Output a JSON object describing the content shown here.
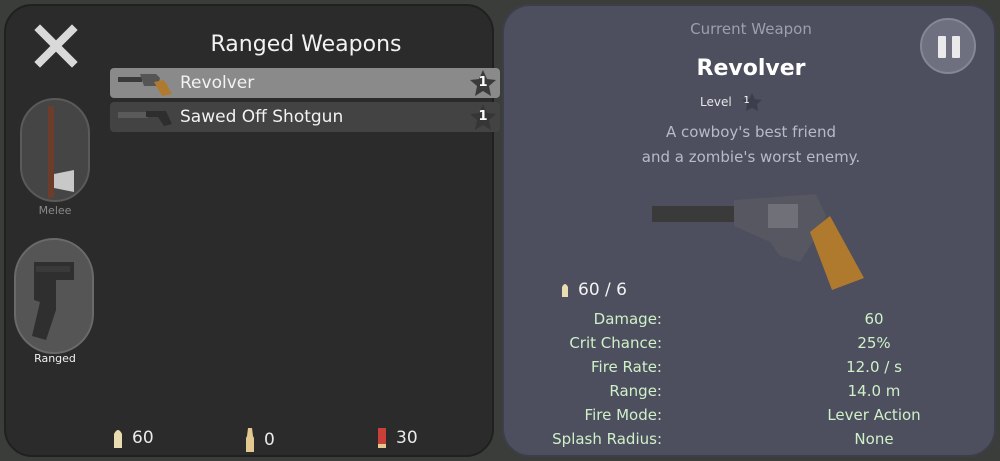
{
  "left": {
    "title": "Ranged Weapons",
    "categories": [
      {
        "label": "Melee",
        "icon": "axe-icon"
      },
      {
        "label": "Ranged",
        "icon": "pistol-icon"
      }
    ],
    "weapons": [
      {
        "name": "Revolver",
        "level": "1",
        "selected": true,
        "icon": "revolver-icon"
      },
      {
        "name": "Sawed Off Shotgun",
        "level": "1",
        "selected": false,
        "icon": "shotgun-icon"
      }
    ],
    "ammo": [
      {
        "icon": "pistol-ammo-icon",
        "count": "60"
      },
      {
        "icon": "rifle-ammo-icon",
        "count": "0"
      },
      {
        "icon": "shotgun-shell-icon",
        "count": "30"
      }
    ]
  },
  "right": {
    "header": "Current Weapon",
    "weapon_name": "Revolver",
    "level_label": "Level",
    "level_value": "1",
    "description_line1": "A cowboy's best friend",
    "description_line2": "and a zombie's worst enemy.",
    "magazine": "60 / 6",
    "stats": [
      {
        "label": "Damage:",
        "value": "60"
      },
      {
        "label": "Crit Chance:",
        "value": "25%"
      },
      {
        "label": "Fire Rate:",
        "value": "12.0 / s"
      },
      {
        "label": "Range:",
        "value": "14.0 m"
      },
      {
        "label": "Fire Mode:",
        "value": "Lever Action"
      },
      {
        "label": "Splash Radius:",
        "value": "None"
      }
    ]
  },
  "colors": {
    "stat_text": "#cff0c8",
    "selected_row": "#8a8a8a",
    "revolver_grip": "#b07a2e"
  }
}
